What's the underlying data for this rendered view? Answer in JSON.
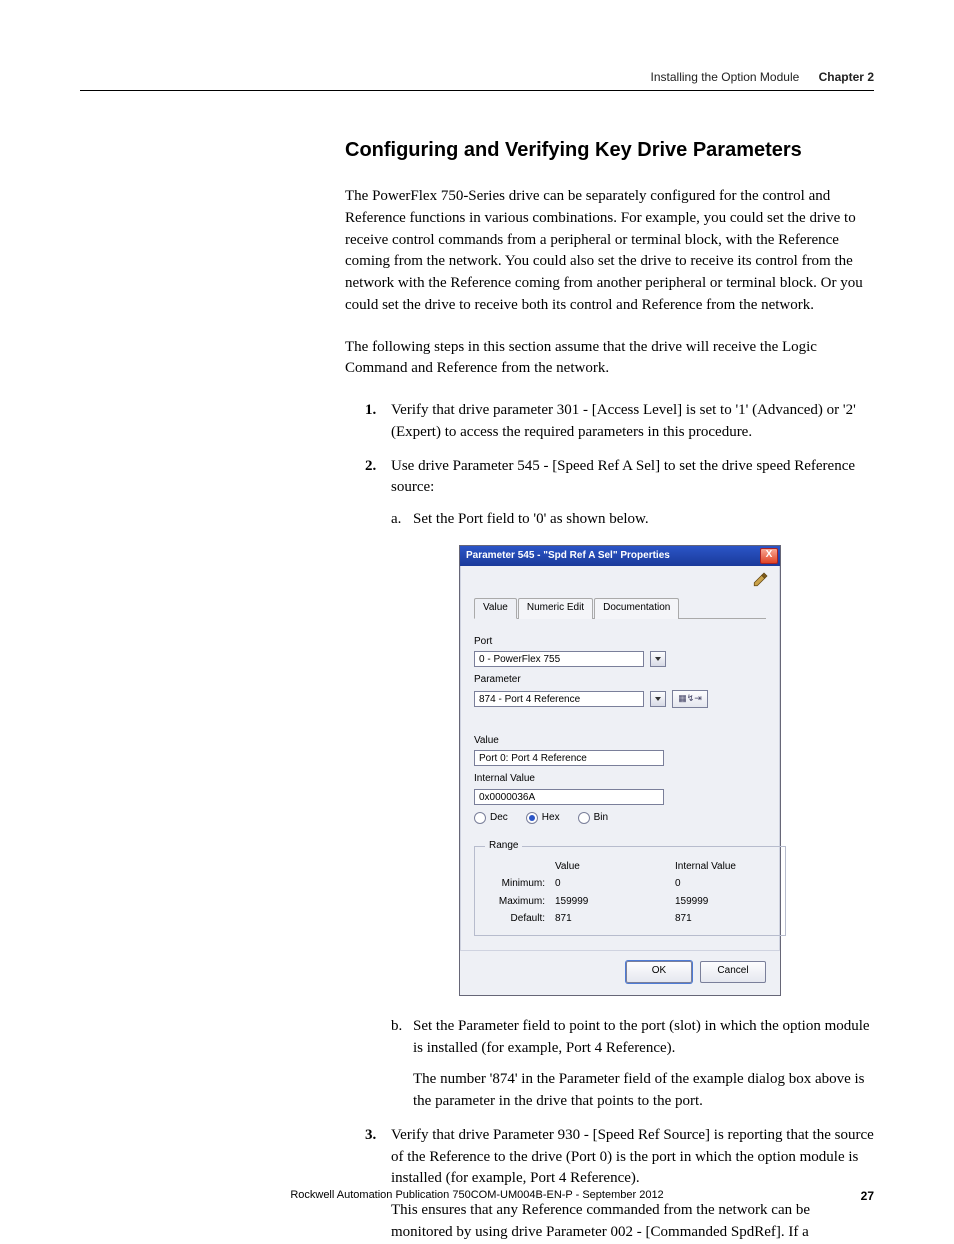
{
  "header": {
    "left": "Installing the Option Module",
    "right": "Chapter 2"
  },
  "section_title": "Configuring and Verifying Key Drive Parameters",
  "para1": "The PowerFlex 750-Series drive can be separately configured for the control and Reference functions in various combinations. For example, you could set the drive to receive control commands from a peripheral or terminal block, with the Reference coming from the network. You could also set the drive to receive its control from the network with the Reference coming from another peripheral or terminal block. Or you could set the drive to receive both its control and Reference from the network.",
  "para2": "The following steps in this section assume that the drive will receive the Logic Command and Reference from the network.",
  "steps": {
    "s1": "Verify that drive parameter 301 - [Access Level] is set to '1' (Advanced) or '2' (Expert) to access the required parameters in this procedure.",
    "s2": "Use drive Parameter 545 - [Speed Ref A Sel] to set the drive speed Reference source:",
    "s2a": "Set the Port field to '0' as shown below.",
    "s2b": "Set the Parameter field to point to the port (slot) in which the option module is installed (for example, Port 4 Reference).",
    "s2b_follow": "The number '874' in the Parameter field of the example dialog box above is the parameter in the drive that points to the port.",
    "s3": "Verify that drive Parameter 930 - [Speed Ref Source] is reporting that the source of the Reference to the drive (Port 0) is the port in which the option module is installed (for example, Port 4 Reference).",
    "s3_follow": "This ensures that any Reference commanded from the network can be monitored by using drive Parameter 002 - [Commanded SpdRef]. If a"
  },
  "dialog": {
    "title": "Parameter 545 - \"Spd Ref A Sel\" Properties",
    "close_x": "X",
    "tabs": {
      "t1": "Value",
      "t2": "Numeric Edit",
      "t3": "Documentation"
    },
    "port_label": "Port",
    "port_value": "0 - PowerFlex 755",
    "param_label": "Parameter",
    "param_value": "874 - Port 4 Reference",
    "pick_glyph": "▦↯⇥",
    "value_label": "Value",
    "value_value": "Port 0: Port 4 Reference",
    "internal_label": "Internal Value",
    "internal_value": "0x0000036A",
    "radios": {
      "dec": "Dec",
      "hex": "Hex",
      "bin": "Bin"
    },
    "range": {
      "legend": "Range",
      "h_value": "Value",
      "h_ival": "Internal Value",
      "min_label": "Minimum:",
      "max_label": "Maximum:",
      "def_label": "Default:",
      "min_v": "0",
      "min_iv": "0",
      "max_v": "159999",
      "max_iv": "159999",
      "def_v": "871",
      "def_iv": "871"
    },
    "ok": "OK",
    "cancel": "Cancel"
  },
  "footer": {
    "pub": "Rockwell Automation Publication 750COM-UM004B-EN-P - September 2012",
    "page": "27"
  }
}
